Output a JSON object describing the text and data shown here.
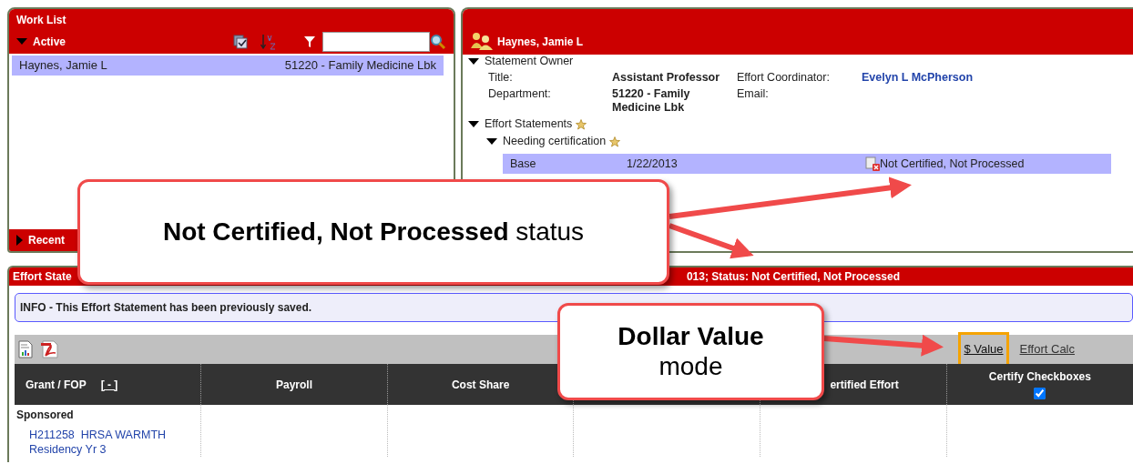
{
  "work_list": {
    "title": "Work List",
    "active_section": {
      "label": "Active",
      "expanded": true
    },
    "rows": [
      {
        "name": "Haynes, Jamie L",
        "department": "51220 - Family Medicine Lbk",
        "selected": true
      }
    ],
    "recent_section": {
      "label": "Recent",
      "expanded": false
    }
  },
  "detail": {
    "title": "Haynes, Jamie L",
    "owner": {
      "label": "Statement Owner",
      "expanded": true,
      "title_label": "Title:",
      "title_value": "Assistant Professor",
      "department_label": "Department:",
      "department_value": "51220 - Family Medicine Lbk",
      "coordinator_label": "Effort Coordinator:",
      "coordinator_value": "Evelyn L McPherson",
      "email_label": "Email:"
    },
    "statements": {
      "label": "Effort Statements",
      "expanded": true,
      "children": [
        {
          "label": "Needing certification",
          "expanded": true,
          "rows": [
            {
              "type": "Base",
              "date": "1/22/2013",
              "status": "Not Certified, Not Processed",
              "selected": true
            }
          ]
        }
      ]
    }
  },
  "statement": {
    "title_start": "Effort State",
    "title_end": "013; Status: Not Certified, Not Processed",
    "info": "INFO - This Effort Statement has been previously saved.",
    "modes": [
      {
        "label": "$ Value",
        "selected": true
      },
      {
        "label": "Effort Calc",
        "selected": false
      }
    ],
    "columns": [
      {
        "label": "Grant / FOP",
        "toggle": "[ - ]"
      },
      {
        "label": "Payroll"
      },
      {
        "label": "Cost Share"
      },
      {
        "label": "ertified Effort"
      },
      {
        "label": "Certify Checkboxes",
        "checked": true
      }
    ],
    "rows": [
      {
        "kind": "group",
        "label": "Sponsored"
      },
      {
        "kind": "grant",
        "label": "H211258  HRSA WARMTH Residency Yr 3"
      }
    ]
  },
  "callouts": [
    {
      "text": "**Not Certified, Not Processed** status"
    },
    {
      "title": "Dollar Value",
      "text": "mode"
    }
  ]
}
